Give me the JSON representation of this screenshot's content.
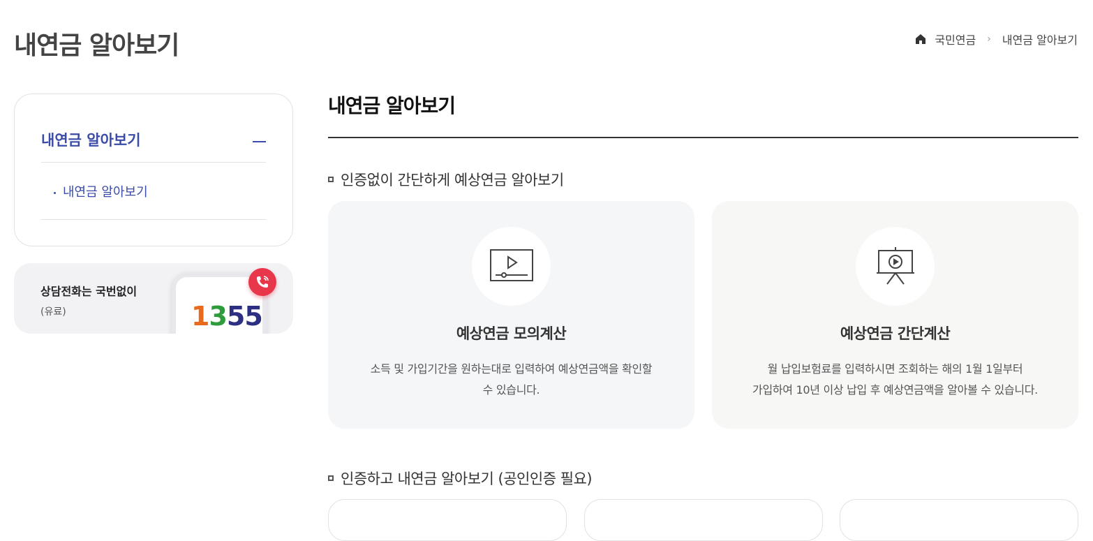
{
  "page_title": "내연금 알아보기",
  "breadcrumb": {
    "home_icon": "home-icon",
    "item1": "국민연금",
    "sep": "›",
    "item2": "내연금 알아보기"
  },
  "sidenav": {
    "heading": "내연금 알아보기",
    "subitem": "내연금 알아보기",
    "collapse_icon": "minus-icon"
  },
  "callbanner": {
    "line1": "상담전화는 국번없이",
    "line2": "(유료)",
    "number_parts": [
      "1",
      "3",
      "5",
      "5"
    ],
    "number_colors": [
      "#e86a1c",
      "#2e9c3b",
      "#2d2f82",
      "#2d2f82"
    ]
  },
  "content": {
    "title": "내연금 알아보기",
    "section1": "인증없이 간단하게 예상연금 알아보기",
    "cards": [
      {
        "icon": "video-player-icon",
        "title": "예상연금 모의계산",
        "desc_line1": "소득 및 가입기간을 원하는대로 입력하여 예상연금액을 확인할",
        "desc_line2": "수 있습니다."
      },
      {
        "icon": "presentation-easel-icon",
        "title": "예상연금 간단계산",
        "desc_line1": "월 납입보험료를 입력하시면 조회하는 해의 1월 1일부터",
        "desc_line2": "가입하여 10년 이상 납입 후 예상연금액을 알아볼 수 있습니다."
      }
    ],
    "section2": "인증하고 내연금 알아보기 (공인인증 필요)"
  },
  "colors": {
    "accent": "#3b4ba8",
    "call_red": "#e8364a"
  }
}
